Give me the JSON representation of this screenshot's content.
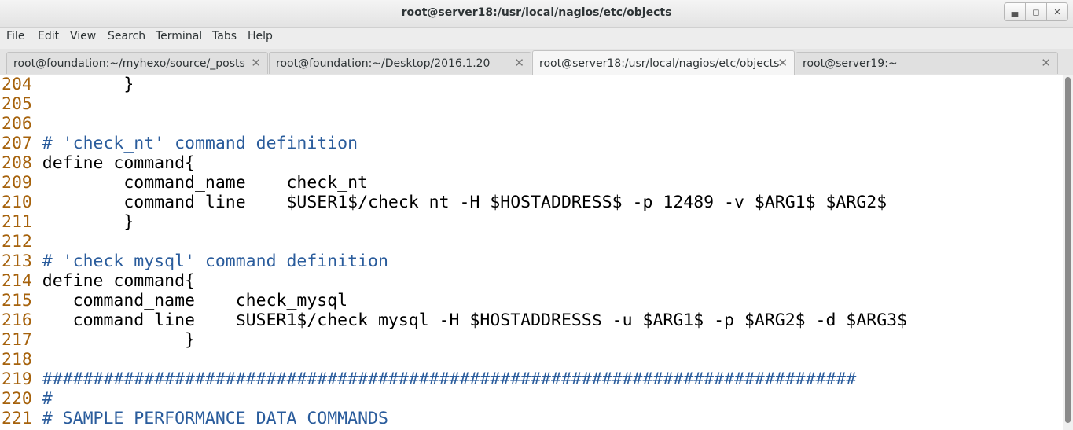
{
  "window": {
    "title": "root@server18:/usr/local/nagios/etc/objects",
    "buttons": [
      "minimize",
      "maximize",
      "close"
    ]
  },
  "menu": [
    "File",
    "Edit",
    "View",
    "Search",
    "Terminal",
    "Tabs",
    "Help"
  ],
  "tabs": [
    {
      "label": "root@foundation:~/myhexo/source/_posts",
      "active": false
    },
    {
      "label": "root@foundation:~/Desktop/2016.1.20",
      "active": false
    },
    {
      "label": "root@server18:/usr/local/nagios/etc/objects",
      "active": true
    },
    {
      "label": "root@server19:~",
      "active": false
    }
  ],
  "lines": [
    {
      "num": "204",
      "text": "        }",
      "kind": "code"
    },
    {
      "num": "205",
      "text": "",
      "kind": "code"
    },
    {
      "num": "206",
      "text": "",
      "kind": "code"
    },
    {
      "num": "207",
      "text": "# 'check_nt' command definition",
      "kind": "comment"
    },
    {
      "num": "208",
      "text": "define command{",
      "kind": "code"
    },
    {
      "num": "209",
      "text": "        command_name    check_nt",
      "kind": "code"
    },
    {
      "num": "210",
      "text": "        command_line    $USER1$/check_nt -H $HOSTADDRESS$ -p 12489 -v $ARG1$ $ARG2$",
      "kind": "code"
    },
    {
      "num": "211",
      "text": "        }",
      "kind": "code"
    },
    {
      "num": "212",
      "text": "",
      "kind": "code"
    },
    {
      "num": "213",
      "text": "# 'check_mysql' command definition",
      "kind": "comment"
    },
    {
      "num": "214",
      "text": "define command{",
      "kind": "code"
    },
    {
      "num": "215",
      "text": "   command_name    check_mysql",
      "kind": "code"
    },
    {
      "num": "216",
      "text": "   command_line    $USER1$/check_mysql -H $HOSTADDRESS$ -u $ARG1$ -p $ARG2$ -d $ARG3$",
      "kind": "code"
    },
    {
      "num": "217",
      "text": "              }",
      "kind": "code"
    },
    {
      "num": "218",
      "text": "",
      "kind": "code"
    },
    {
      "num": "219",
      "text": "################################################################################",
      "kind": "comment"
    },
    {
      "num": "220",
      "text": "#",
      "kind": "comment"
    },
    {
      "num": "221",
      "text": "# SAMPLE PERFORMANCE DATA COMMANDS",
      "kind": "comment"
    }
  ],
  "colors": {
    "line_number": "#a6620c",
    "comment": "#2a5c9c",
    "code": "#000000"
  }
}
